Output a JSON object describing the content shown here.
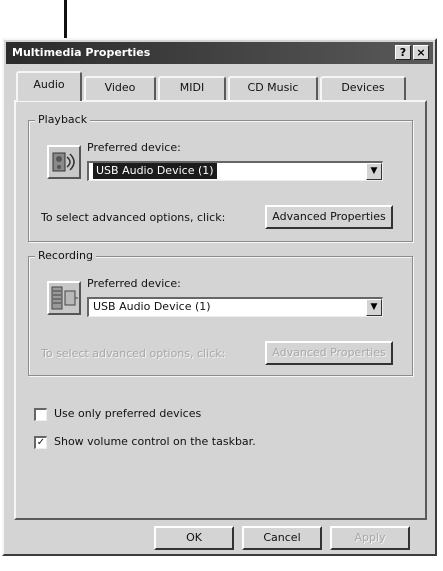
{
  "window": {
    "title": "Multimedia Properties",
    "help_label": "?",
    "close_label": "×"
  },
  "tabs": [
    {
      "label": "Audio",
      "active": true
    },
    {
      "label": "Video",
      "active": false
    },
    {
      "label": "MIDI",
      "active": false
    },
    {
      "label": "CD Music",
      "active": false
    },
    {
      "label": "Devices",
      "active": false
    }
  ],
  "playback": {
    "group_label": "Playback",
    "preferred_label": "Preferred device:",
    "device_value": "USB Audio Device (1)",
    "advanced_text": "To select advanced options, click:",
    "advanced_button": "Advanced Properties",
    "icon": "speaker-icon"
  },
  "recording": {
    "group_label": "Recording",
    "preferred_label": "Preferred device:",
    "device_value": "USB Audio Device (1)",
    "advanced_text": "To select advanced options, click:",
    "advanced_button": "Advanced Properties",
    "icon": "microphone-icon"
  },
  "options": {
    "use_preferred_label": "Use only preferred devices",
    "use_preferred_checked": false,
    "show_volume_label": "Show volume control on the taskbar.",
    "show_volume_checked": true
  },
  "buttons": {
    "ok": "OK",
    "cancel": "Cancel",
    "apply": "Apply"
  }
}
